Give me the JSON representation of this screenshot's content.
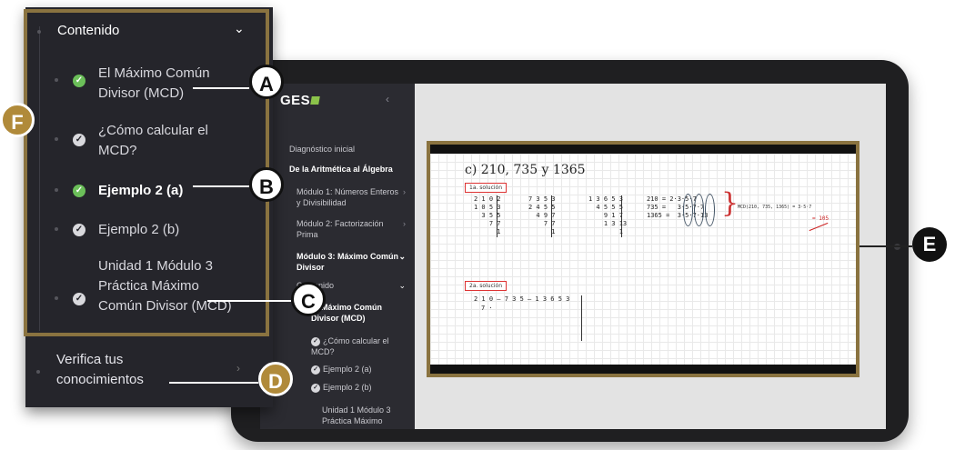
{
  "colors": {
    "frame_gold": "#8a7340",
    "badge_gold": "#b08a3a",
    "check_green": "#6bbf59",
    "sidebar_bg": "#2b2b31"
  },
  "app": {
    "logo": "GES",
    "collapse_icon": "chevron-left-icon",
    "items": [
      {
        "label": "Diagnóstico inicial",
        "bold": false
      },
      {
        "label": "De la Aritmética al Álgebra",
        "bold": true
      },
      {
        "label": "Módulo 1: Números Enteros y Divisibilidad",
        "bold": false
      },
      {
        "label": "Módulo 2: Factorización Prima",
        "bold": false
      },
      {
        "label": "Módulo 3: Máximo Común Divisor",
        "bold": true
      },
      {
        "label": "Contenido",
        "bold": false
      },
      {
        "label": "El Máximo Común Divisor (MCD)",
        "bold": true
      },
      {
        "label": "¿Cómo calcular el MCD?",
        "bold": false
      },
      {
        "label": "Ejemplo 2 (a)",
        "bold": false
      },
      {
        "label": "Ejemplo 2 (b)",
        "bold": false
      },
      {
        "label": "Unidad 1 Módulo 3 Práctica Máximo",
        "bold": false
      }
    ]
  },
  "whiteboard": {
    "title": "c)  210, 735 y 1365",
    "tag1": "1a. solución",
    "tag2": "2a. solución",
    "col1": "2 1 0 2\n1 0 5 3\n  3 5 5\n    7 7\n      1",
    "col2": "7 3 5 3\n2 4 5 5\n  4 9 7\n    7 7\n      1",
    "col3": "1 3 6 5 3\n  4 5 5 5\n    9 1 7\n    1 3 13\n        1",
    "factors": "210 = 2·3·5·7\n735 =   3·5·7·7\n1365 =  3·5·7·13",
    "mcd_note": "MCD(210, 735, 1365) = 3·5·7",
    "mcd_result": "= 105",
    "row2": "2 1 0 – 7 3 5 – 1 3 6 5 3",
    "row2b": "7 ·"
  },
  "zoom": {
    "header": "Contenido",
    "items": [
      {
        "label": "El Máximo Común Divisor (MCD)",
        "active": true,
        "bold": false
      },
      {
        "label": "¿Cómo calcular el MCD?",
        "active": false,
        "bold": false
      },
      {
        "label": "Ejemplo 2 (a)",
        "active": true,
        "bold": true
      },
      {
        "label": "Ejemplo 2 (b)",
        "active": false,
        "bold": false
      },
      {
        "label": "Unidad 1 Módulo 3 Práctica Máximo Común Divisor (MCD)",
        "active": false,
        "bold": false
      }
    ],
    "verify": "Verifica tus conocimientos"
  },
  "badges": {
    "a": "A",
    "b": "B",
    "c": "C",
    "d": "D",
    "e": "E",
    "f": "F"
  }
}
